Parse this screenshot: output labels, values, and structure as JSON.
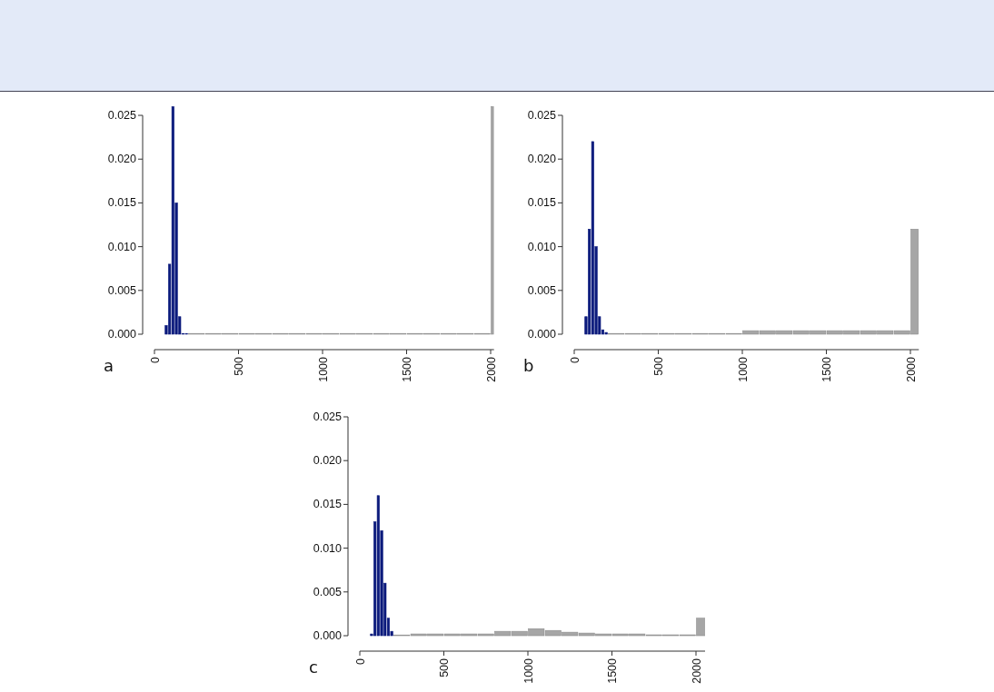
{
  "panels": [
    {
      "label": "a",
      "chart_data": {
        "type": "bar",
        "x": [
          70,
          90,
          110,
          130,
          150,
          170,
          190,
          250,
          350,
          450,
          550,
          650,
          750,
          850,
          950,
          1050,
          1150,
          1250,
          1350,
          1450,
          1550,
          1650,
          1750,
          1850,
          1950,
          2010
        ],
        "xlim": [
          0,
          2020
        ],
        "ylim": [
          0,
          0.026
        ],
        "series": [
          {
            "color": "#0b1a7c",
            "values": [
              0.001,
              0.008,
              0.026,
              0.015,
              0.002,
              0,
              0,
              null,
              null,
              null,
              null,
              null,
              null,
              null,
              null,
              null,
              null,
              null,
              null,
              null,
              null,
              null,
              null,
              null,
              null,
              null
            ]
          },
          {
            "color": "#a6a6a6",
            "values": [
              null,
              null,
              null,
              null,
              null,
              null,
              null,
              0,
              0,
              0,
              0,
              0,
              0,
              0,
              0,
              0,
              0,
              0,
              0,
              0,
              0,
              0,
              0,
              0,
              0,
              0.026
            ]
          }
        ],
        "xticks": [
          0,
          500,
          1000,
          1500,
          2000
        ],
        "yticks": [
          {
            "value": 0,
            "label": "0.000"
          },
          {
            "value": 0.005,
            "label": "0.005"
          },
          {
            "value": 0.01,
            "label": "0.010"
          },
          {
            "value": 0.015,
            "label": "0.015"
          },
          {
            "value": 0.02,
            "label": "0.020"
          },
          {
            "value": 0.025,
            "label": "0.025"
          }
        ]
      }
    },
    {
      "label": "b",
      "chart_data": {
        "type": "bar",
        "x": [
          70,
          90,
          110,
          130,
          150,
          170,
          190,
          250,
          350,
          450,
          550,
          650,
          750,
          850,
          950,
          1050,
          1150,
          1250,
          1350,
          1450,
          1550,
          1650,
          1750,
          1850,
          1950,
          2025
        ],
        "xlim": [
          0,
          2050
        ],
        "ylim": [
          0,
          0.025
        ],
        "series": [
          {
            "color": "#0b1a7c",
            "values": [
              0.002,
              0.012,
              0.022,
              0.01,
              0.002,
              0.0005,
              0.0002,
              null,
              null,
              null,
              null,
              null,
              null,
              null,
              null,
              null,
              null,
              null,
              null,
              null,
              null,
              null,
              null,
              null,
              null,
              null
            ]
          },
          {
            "color": "#a6a6a6",
            "values": [
              null,
              null,
              null,
              null,
              null,
              null,
              null,
              0,
              0,
              0,
              0,
              0,
              0,
              0,
              0,
              0.0004,
              0.0004,
              0.0004,
              0.0004,
              0.0004,
              0.0004,
              0.0004,
              0.0004,
              0.0004,
              0.0004,
              0.012
            ]
          }
        ],
        "xticks": [
          0,
          500,
          1000,
          1500,
          2000
        ],
        "yticks": [
          {
            "value": 0,
            "label": "0.000"
          },
          {
            "value": 0.005,
            "label": "0.005"
          },
          {
            "value": 0.01,
            "label": "0.010"
          },
          {
            "value": 0.015,
            "label": "0.015"
          },
          {
            "value": 0.02,
            "label": "0.020"
          },
          {
            "value": 0.025,
            "label": "0.025"
          }
        ]
      }
    },
    {
      "label": "c",
      "chart_data": {
        "type": "bar",
        "x": [
          70,
          90,
          110,
          130,
          150,
          170,
          190,
          250,
          350,
          450,
          550,
          650,
          750,
          850,
          950,
          1050,
          1150,
          1250,
          1350,
          1450,
          1550,
          1650,
          1750,
          1850,
          1950,
          2040
        ],
        "xlim": [
          0,
          2080
        ],
        "ylim": [
          0,
          0.025
        ],
        "series": [
          {
            "color": "#0b1a7c",
            "values": [
              0.0002,
              0.013,
              0.016,
              0.012,
              0.006,
              0.002,
              0.0005,
              null,
              null,
              null,
              null,
              null,
              null,
              null,
              null,
              null,
              null,
              null,
              null,
              null,
              null,
              null,
              null,
              null,
              null,
              null
            ]
          },
          {
            "color": "#a6a6a6",
            "values": [
              null,
              null,
              null,
              null,
              null,
              null,
              null,
              0,
              0.0002,
              0.0002,
              0.0002,
              0.0002,
              0.0002,
              0.0005,
              0.0005,
              0.0008,
              0.0006,
              0.0004,
              0.0003,
              0.0002,
              0.0002,
              0.0002,
              0.0001,
              0.0001,
              0.0001,
              0.002
            ]
          }
        ],
        "xticks": [
          0,
          500,
          1000,
          1500,
          2000
        ],
        "yticks": [
          {
            "value": 0,
            "label": "0.000"
          },
          {
            "value": 0.005,
            "label": "0.005"
          },
          {
            "value": 0.01,
            "label": "0.010"
          },
          {
            "value": 0.015,
            "label": "0.015"
          },
          {
            "value": 0.02,
            "label": "0.020"
          },
          {
            "value": 0.025,
            "label": "0.025"
          }
        ]
      }
    }
  ]
}
